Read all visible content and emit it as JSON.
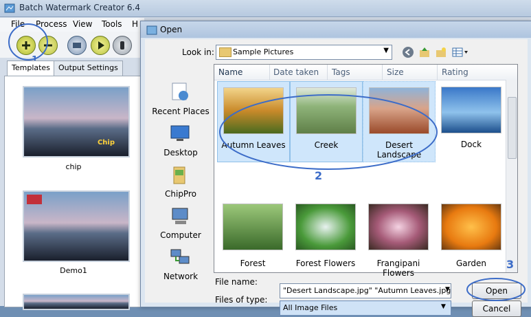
{
  "app": {
    "title": "Batch Watermark Creator 6.4"
  },
  "menu": [
    "File",
    "Process",
    "View",
    "Tools",
    "H"
  ],
  "left_tabs": [
    "Templates",
    "Output Settings"
  ],
  "templates": [
    "chip",
    "Demo1"
  ],
  "thumb_overlay": "Chip",
  "dialog": {
    "title": "Open",
    "look_in_label": "Look in:",
    "look_in_value": "Sample Pictures",
    "places": [
      "Recent Places",
      "Desktop",
      "ChipPro",
      "Computer",
      "Network"
    ],
    "columns": [
      "Name",
      "Date taken",
      "Tags",
      "Size",
      "Rating"
    ],
    "files_row1": [
      "Autumn Leaves",
      "Creek",
      "Desert Landscape",
      "Dock"
    ],
    "files_row2": [
      "Forest",
      "Forest Flowers",
      "Frangipani Flowers",
      "Garden"
    ],
    "file_name_label": "File name:",
    "file_name_value": "\"Desert Landscape.jpg\" \"Autumn Leaves.jpg\"",
    "files_of_type_label": "Files of type:",
    "files_of_type_value": "All Image Files",
    "open_button": "Open",
    "cancel_button": "Cancel"
  },
  "annotations": {
    "one": "1",
    "two": "2",
    "three": "3"
  },
  "colors": {
    "annotation": "#3c6cc8",
    "selection": "#cfe6fb"
  }
}
